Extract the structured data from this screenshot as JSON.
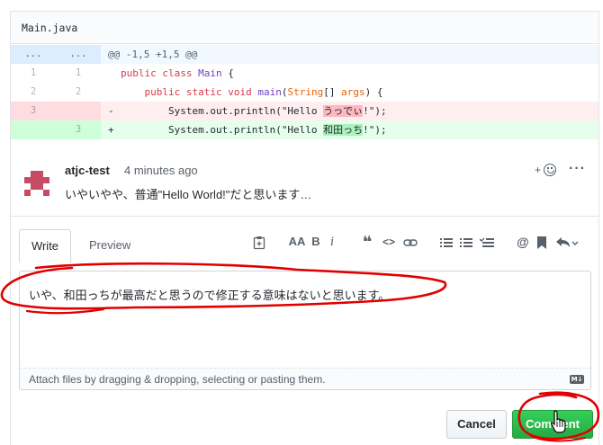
{
  "file": {
    "name": "Main.java"
  },
  "diff": {
    "hunk": {
      "ln1": "...",
      "ln2": "...",
      "text": "@@ -1,5 +1,5 @@"
    },
    "lines": [
      {
        "ln1": "1",
        "ln2": "1",
        "kw1": "public",
        "kw2": "class",
        "name": "Main",
        "rest": " {"
      },
      {
        "ln1": "2",
        "ln2": "2",
        "kw1": "public",
        "kw2": "static",
        "kw3": "void",
        "fn": "main",
        "p1": "(",
        "type": "String",
        "p2": "[] ",
        "arg": "args",
        "p3": ") {"
      },
      {
        "ln1": "3",
        "ln2": "",
        "sign": "-",
        "pre": "System.out.println(\"Hello ",
        "hl": "うっでぃ",
        "post": "!\");"
      },
      {
        "ln1": "",
        "ln2": "3",
        "sign": "+",
        "pre": "System.out.println(\"Hello ",
        "hl": "和田っち",
        "post": "!\");"
      }
    ]
  },
  "comment": {
    "author": "atjc-test",
    "time": "4 minutes ago",
    "body": "いやいやや、普通\"Hello World!\"だと思います…",
    "react_plus": "+",
    "more": "···"
  },
  "composer": {
    "tab_write": "Write",
    "tab_preview": "Preview",
    "toolbar": {
      "header": "AA",
      "bold": "B",
      "italic": "i",
      "quote": "❝",
      "code": "<>",
      "mention": "@"
    },
    "text": "いや、和田っちが最高だと思うので修正する意味はないと思います。",
    "attach": "Attach files by dragging & dropping, selecting or pasting them.",
    "md_badge": "M↓",
    "cancel_label": "Cancel",
    "comment_label": "Comment"
  },
  "colors": {
    "accent_green": "#28a745",
    "annotation_red": "#e00000",
    "deletion_bg": "#ffeef0",
    "addition_bg": "#e6ffed"
  }
}
